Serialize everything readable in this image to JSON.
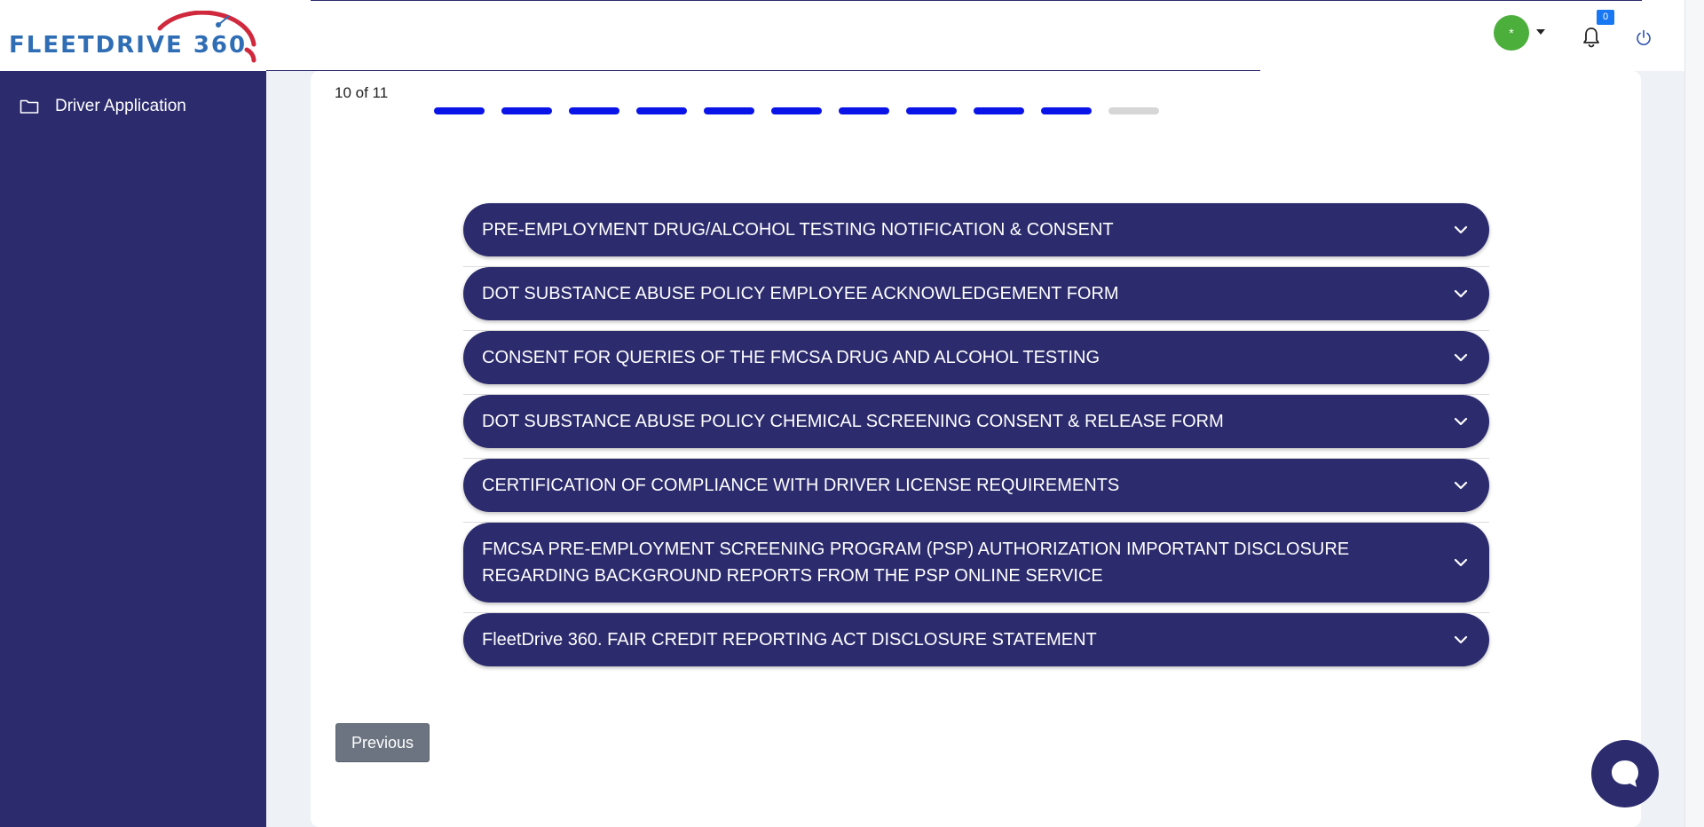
{
  "brand": {
    "logo_text_a": "FLEETDRIVE",
    "logo_text_b": "360",
    "primary_color": "#2c2b6e",
    "progress_color": "#0a14e8",
    "logo_arc_color": "#d0283c"
  },
  "header": {
    "avatar_initial": "*",
    "notification_count": "0"
  },
  "sidebar": {
    "items": [
      {
        "label": "Driver Application",
        "icon": "folder-icon"
      }
    ]
  },
  "wizard": {
    "step_text": "10 of 11",
    "total_steps": 11,
    "completed_steps": 10
  },
  "accordions": [
    {
      "title": "PRE-EMPLOYMENT DRUG/ALCOHOL TESTING NOTIFICATION & CONSENT"
    },
    {
      "title": "DOT SUBSTANCE ABUSE POLICY EMPLOYEE ACKNOWLEDGEMENT FORM"
    },
    {
      "title": "CONSENT FOR QUERIES OF THE FMCSA DRUG AND ALCOHOL TESTING"
    },
    {
      "title": "DOT SUBSTANCE ABUSE POLICY CHEMICAL SCREENING CONSENT & RELEASE FORM"
    },
    {
      "title": "CERTIFICATION OF COMPLIANCE WITH DRIVER LICENSE REQUIREMENTS"
    },
    {
      "title": "FMCSA PRE-EMPLOYMENT SCREENING PROGRAM (PSP) AUTHORIZATION IMPORTANT DISCLOSURE REGARDING BACKGROUND REPORTS FROM THE PSP ONLINE SERVICE"
    },
    {
      "title": "FleetDrive 360. FAIR CREDIT REPORTING ACT DISCLOSURE STATEMENT"
    }
  ],
  "actions": {
    "previous_label": "Previous"
  }
}
